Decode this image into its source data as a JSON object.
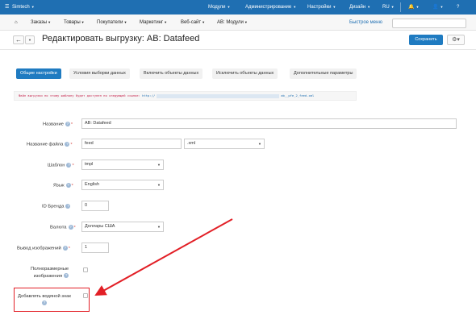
{
  "topbar": {
    "brand": "Simtech",
    "menus": [
      "Модули",
      "Администрирование",
      "Настройки",
      "Дизайн",
      "RU"
    ]
  },
  "nav": {
    "items": [
      "Заказы",
      "Товары",
      "Покупатели",
      "Маркетинг",
      "Веб-сайт",
      "AB: Модули"
    ],
    "quick_menu": "Быстрое меню"
  },
  "header": {
    "title": "Редактировать выгрузку: AB: Datafeed",
    "save_label": "Сохранить"
  },
  "tabs": [
    "Общие настройки",
    "Условия выборки данных",
    "Включить объекты данных",
    "Исключить объекты данных",
    "Дополнительные параметры"
  ],
  "info": {
    "text": "Файл выгрузки по этому шаблону будет доступен по следующей ссылке:",
    "url_start": "http://",
    "url_end": "ab__pfe_2_feed.xml"
  },
  "form": {
    "name_label": "Название",
    "name_value": "AB: Datafeed",
    "filename_label": "Название файла",
    "filename_value": "feed",
    "ext_value": ".xml",
    "template_label": "Шаблон",
    "template_value": "tmpl",
    "lang_label": "Язык",
    "lang_value": "English",
    "brand_label": "ID Бренда",
    "brand_value": "0",
    "currency_label": "Валюта",
    "currency_value": "Доллары США",
    "images_label": "Вывод изображений",
    "images_value": "1",
    "fullsize_label_1": "Полноразмерные",
    "fullsize_label_2": "изображения",
    "watermark_label": "Добавлять водяной знак"
  },
  "colors": {
    "accent": "#1f7bc1",
    "highlight": "#e21f26"
  }
}
